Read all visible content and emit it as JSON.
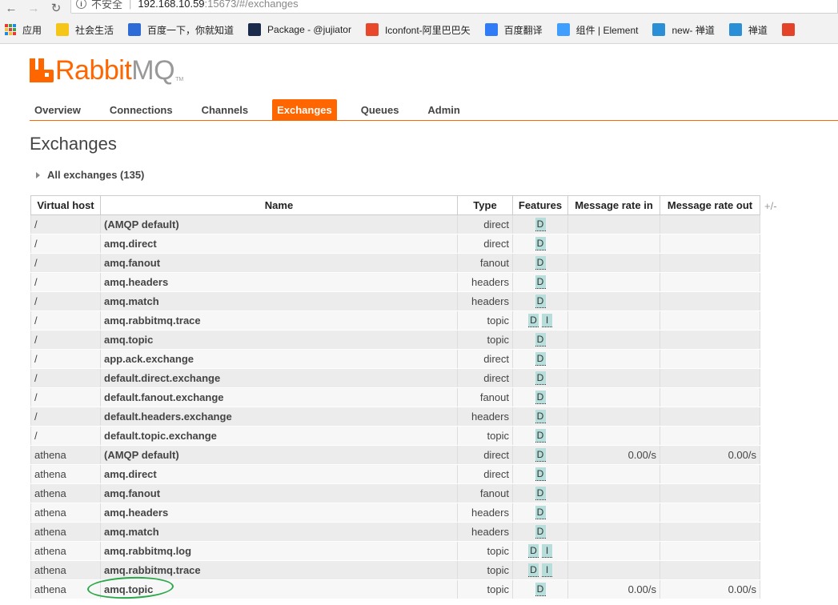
{
  "browser": {
    "security_text": "不安全",
    "url_host": "192.168.10.59",
    "url_path": ":15673/#/exchanges",
    "bookmarks": [
      {
        "label": "应用",
        "icon": "apps-grid-icon",
        "color": "#e53935"
      },
      {
        "label": "社会生活",
        "icon": "folder-icon",
        "color": "#f5c518"
      },
      {
        "label": "百度一下，你就知道",
        "icon": "baidu-paw-icon",
        "color": "#2d6bd6"
      },
      {
        "label": "Package - @jujiator",
        "icon": "n-logo-icon",
        "color": "#1a2a4a"
      },
      {
        "label": "Iconfont-阿里巴巴矢",
        "icon": "iconfont-icon",
        "color": "#e8472c"
      },
      {
        "label": "百度翻译",
        "icon": "translate-icon",
        "color": "#2f7cf6"
      },
      {
        "label": "组件 | Element",
        "icon": "element-icon",
        "color": "#409eff"
      },
      {
        "label": "new- 禅道",
        "icon": "zentao-globe-icon",
        "color": "#2a8fd6"
      },
      {
        "label": "禅道",
        "icon": "zentao-globe-icon",
        "color": "#2a8fd6"
      },
      {
        "label": "",
        "icon": "gitlab-icon",
        "color": "#e24329"
      }
    ]
  },
  "app": {
    "logo_rabbit": "Rabbit",
    "logo_mq": "MQ",
    "logo_tm": "TM",
    "brand_color": "#ff6600",
    "tabs": [
      {
        "label": "Overview",
        "active": false
      },
      {
        "label": "Connections",
        "active": false
      },
      {
        "label": "Channels",
        "active": false
      },
      {
        "label": "Exchanges",
        "active": true
      },
      {
        "label": "Queues",
        "active": false
      },
      {
        "label": "Admin",
        "active": false
      }
    ],
    "page_title": "Exchanges",
    "section_label": "All exchanges (135)",
    "columns_toggle": "+/-"
  },
  "table": {
    "headers": [
      "Virtual host",
      "Name",
      "Type",
      "Features",
      "Message rate in",
      "Message rate out"
    ],
    "rows": [
      {
        "vhost": "/",
        "name": "(AMQP default)",
        "type": "direct",
        "features": [
          "D"
        ],
        "rate_in": "",
        "rate_out": ""
      },
      {
        "vhost": "/",
        "name": "amq.direct",
        "type": "direct",
        "features": [
          "D"
        ],
        "rate_in": "",
        "rate_out": ""
      },
      {
        "vhost": "/",
        "name": "amq.fanout",
        "type": "fanout",
        "features": [
          "D"
        ],
        "rate_in": "",
        "rate_out": ""
      },
      {
        "vhost": "/",
        "name": "amq.headers",
        "type": "headers",
        "features": [
          "D"
        ],
        "rate_in": "",
        "rate_out": ""
      },
      {
        "vhost": "/",
        "name": "amq.match",
        "type": "headers",
        "features": [
          "D"
        ],
        "rate_in": "",
        "rate_out": ""
      },
      {
        "vhost": "/",
        "name": "amq.rabbitmq.trace",
        "type": "topic",
        "features": [
          "D",
          "I"
        ],
        "rate_in": "",
        "rate_out": ""
      },
      {
        "vhost": "/",
        "name": "amq.topic",
        "type": "topic",
        "features": [
          "D"
        ],
        "rate_in": "",
        "rate_out": ""
      },
      {
        "vhost": "/",
        "name": "app.ack.exchange",
        "type": "direct",
        "features": [
          "D"
        ],
        "rate_in": "",
        "rate_out": ""
      },
      {
        "vhost": "/",
        "name": "default.direct.exchange",
        "type": "direct",
        "features": [
          "D"
        ],
        "rate_in": "",
        "rate_out": ""
      },
      {
        "vhost": "/",
        "name": "default.fanout.exchange",
        "type": "fanout",
        "features": [
          "D"
        ],
        "rate_in": "",
        "rate_out": ""
      },
      {
        "vhost": "/",
        "name": "default.headers.exchange",
        "type": "headers",
        "features": [
          "D"
        ],
        "rate_in": "",
        "rate_out": ""
      },
      {
        "vhost": "/",
        "name": "default.topic.exchange",
        "type": "topic",
        "features": [
          "D"
        ],
        "rate_in": "",
        "rate_out": ""
      },
      {
        "vhost": "athena",
        "name": "(AMQP default)",
        "type": "direct",
        "features": [
          "D"
        ],
        "rate_in": "0.00/s",
        "rate_out": "0.00/s"
      },
      {
        "vhost": "athena",
        "name": "amq.direct",
        "type": "direct",
        "features": [
          "D"
        ],
        "rate_in": "",
        "rate_out": ""
      },
      {
        "vhost": "athena",
        "name": "amq.fanout",
        "type": "fanout",
        "features": [
          "D"
        ],
        "rate_in": "",
        "rate_out": ""
      },
      {
        "vhost": "athena",
        "name": "amq.headers",
        "type": "headers",
        "features": [
          "D"
        ],
        "rate_in": "",
        "rate_out": ""
      },
      {
        "vhost": "athena",
        "name": "amq.match",
        "type": "headers",
        "features": [
          "D"
        ],
        "rate_in": "",
        "rate_out": ""
      },
      {
        "vhost": "athena",
        "name": "amq.rabbitmq.log",
        "type": "topic",
        "features": [
          "D",
          "I"
        ],
        "rate_in": "",
        "rate_out": ""
      },
      {
        "vhost": "athena",
        "name": "amq.rabbitmq.trace",
        "type": "topic",
        "features": [
          "D",
          "I"
        ],
        "rate_in": "",
        "rate_out": ""
      },
      {
        "vhost": "athena",
        "name": "amq.topic",
        "type": "topic",
        "features": [
          "D"
        ],
        "rate_in": "0.00/s",
        "rate_out": "0.00/s",
        "highlighted": true
      }
    ]
  }
}
